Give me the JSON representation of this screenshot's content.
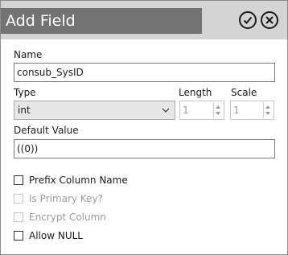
{
  "dialog": {
    "title": "Add Field"
  },
  "fields": {
    "name_label": "Name",
    "name_value": "consub_SysID",
    "type_label": "Type",
    "type_value": "int",
    "length_label": "Length",
    "length_value": "1",
    "scale_label": "Scale",
    "scale_value": "1",
    "default_label": "Default Value",
    "default_value": "((0))"
  },
  "checkboxes": [
    {
      "label": "Prefix Column Name",
      "checked": false,
      "enabled": true
    },
    {
      "label": "Is Primary Key?",
      "checked": false,
      "enabled": false
    },
    {
      "label": "Encrypt Column",
      "checked": false,
      "enabled": false
    },
    {
      "label": "Allow NULL",
      "checked": false,
      "enabled": true
    }
  ],
  "colors": {
    "title_bg": "#737373",
    "titlebar_bg": "#d4d4d4",
    "disabled_text": "#9a9a9a"
  },
  "icons": {
    "ok": "check-circle-icon",
    "close": "x-circle-icon",
    "dropdown": "chevron-down-icon"
  }
}
